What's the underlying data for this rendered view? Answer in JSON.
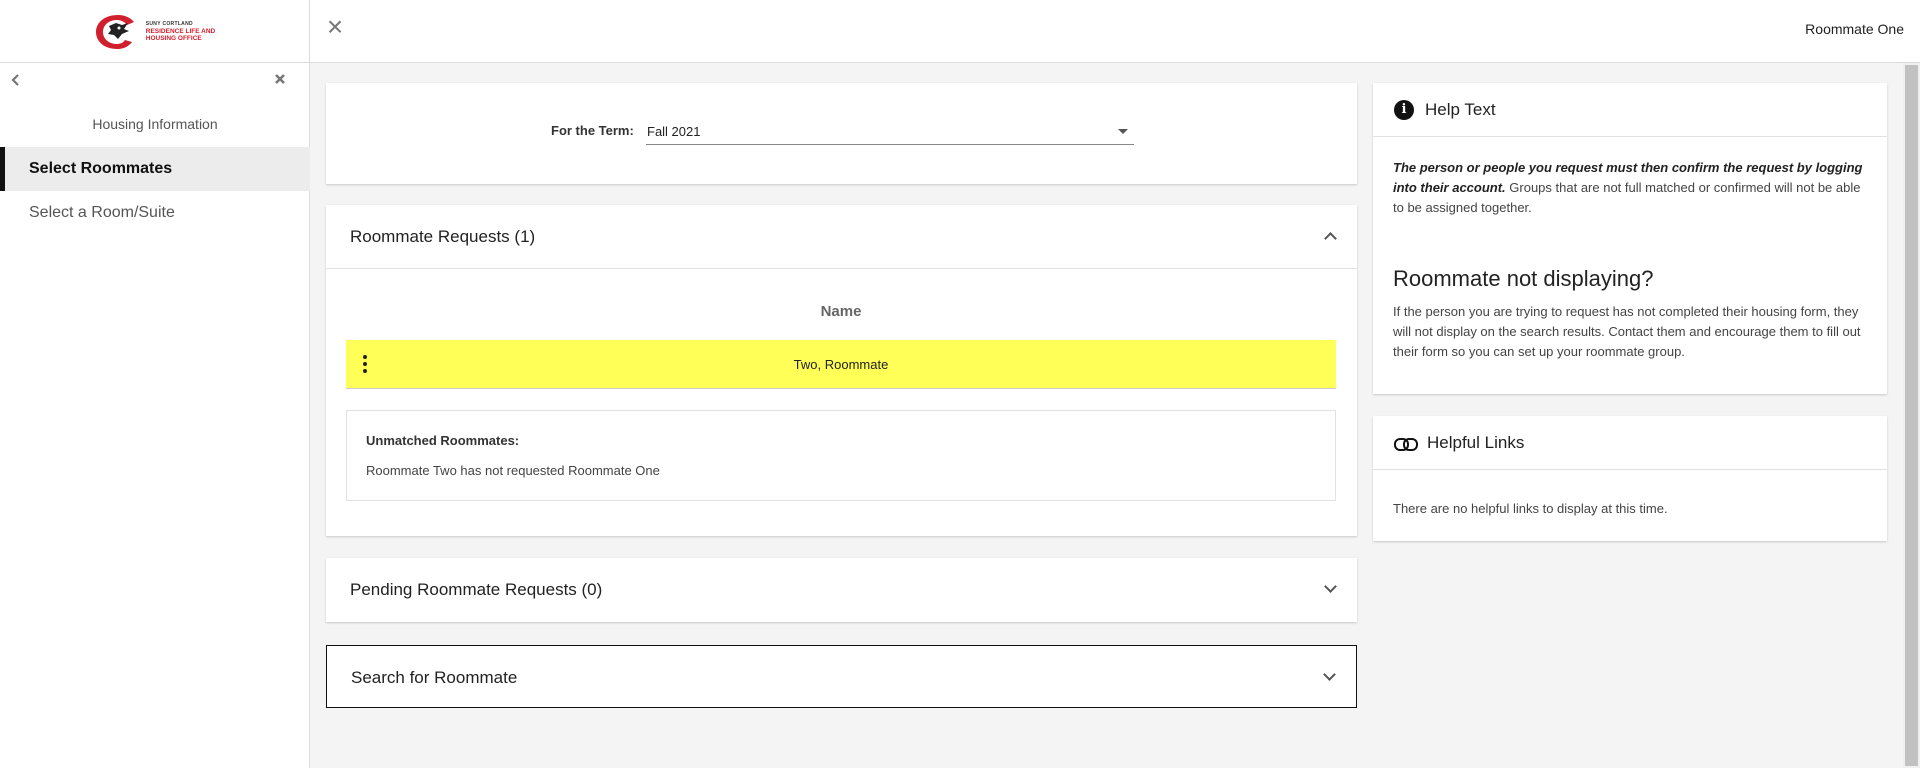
{
  "header": {
    "logo_line1": "SUNY CORTLAND",
    "logo_line2": "RESIDENCE LIFE AND",
    "logo_line3": "HOUSING OFFICE",
    "user_name": "Roommate One"
  },
  "sidebar": {
    "back_icon": "chevron-left-icon",
    "close_icon": "close-icon",
    "heading": "Housing Information",
    "items": [
      {
        "label": "Select Roommates",
        "active": true
      },
      {
        "label": "Select a Room/Suite",
        "active": false
      }
    ]
  },
  "term": {
    "label": "For the Term:",
    "selected": "Fall 2021"
  },
  "roommate_requests": {
    "title": "Roommate Requests (1)",
    "column_header": "Name",
    "rows": [
      {
        "name": "Two, Roommate",
        "highlight": "#ffff57"
      }
    ],
    "unmatched_title": "Unmatched Roommates:",
    "unmatched_text": "Roommate Two has not requested Roommate One"
  },
  "pending": {
    "title": "Pending Roommate Requests (0)"
  },
  "search": {
    "title": "Search for Roommate"
  },
  "help": {
    "title": "Help Text",
    "body_bold": "The person or people you request must then confirm the request by logging into their account.",
    "body_rest": " Groups that are not full matched or confirmed will not be able to be assigned together.",
    "heading2": "Roommate not displaying?",
    "body2": "If the person you are trying to request has not completed their housing form, they will not display on the search results. Contact them and encourage them to fill out their form so you can set up your roommate group."
  },
  "links": {
    "title": "Helpful Links",
    "empty_text": "There are no helpful links to display at this time."
  },
  "colors": {
    "brand_red": "#d0202e",
    "highlight_yellow": "#ffff57"
  }
}
